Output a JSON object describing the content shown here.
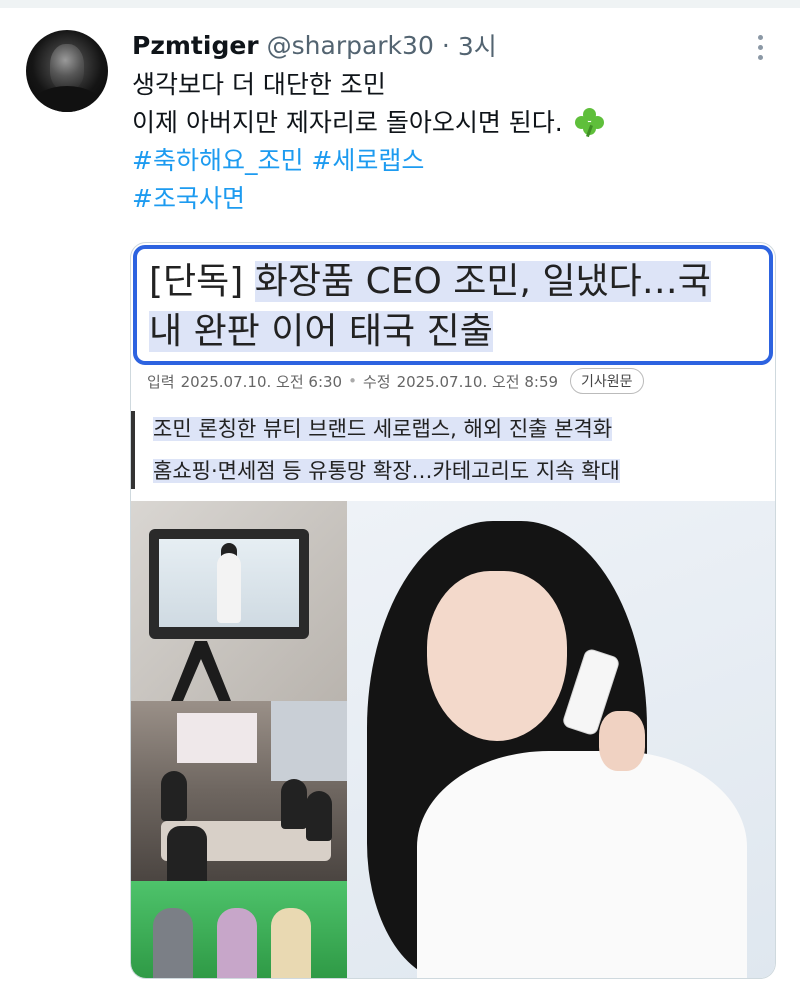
{
  "tweet": {
    "author_name": "Pzmtiger",
    "handle": "@sharpark30",
    "separator": "·",
    "time": "3시",
    "lines": {
      "l1": "생각보다 더 대단한 조민",
      "l2": "이제 아버지만 제자리로 돌아오시면 된다.",
      "hashtag1": "#축하해요_조민",
      "hashtag2": "#세로랩스",
      "hashtag3": "#조국사면"
    }
  },
  "article": {
    "headline_tag": "[단독]",
    "headline_part1": "화장품 CEO 조민, 일냈다…국",
    "headline_part2": "내 완판 이어 태국 진출",
    "meta": {
      "input_label": "입력",
      "input_time": "2025.07.10. 오전 6:30",
      "dot": "•",
      "edit_label": "수정",
      "edit_time": "2025.07.10. 오전 8:59",
      "original_button": "기사원문"
    },
    "sub1": "조민 론칭한 뷰티 브랜드 세로랩스, 해외 진출 본격화",
    "sub2": "홈쇼핑·면세점 등 유통망 확장…카테고리도 지속 확대"
  },
  "colors": {
    "accent": "#1d9bf0",
    "highlight_border": "#2d63e0",
    "highlight_fill": "#dde4f7"
  },
  "icons": {
    "more": "more-dots-vertical-icon",
    "clover": "four-leaf-clover-icon"
  }
}
